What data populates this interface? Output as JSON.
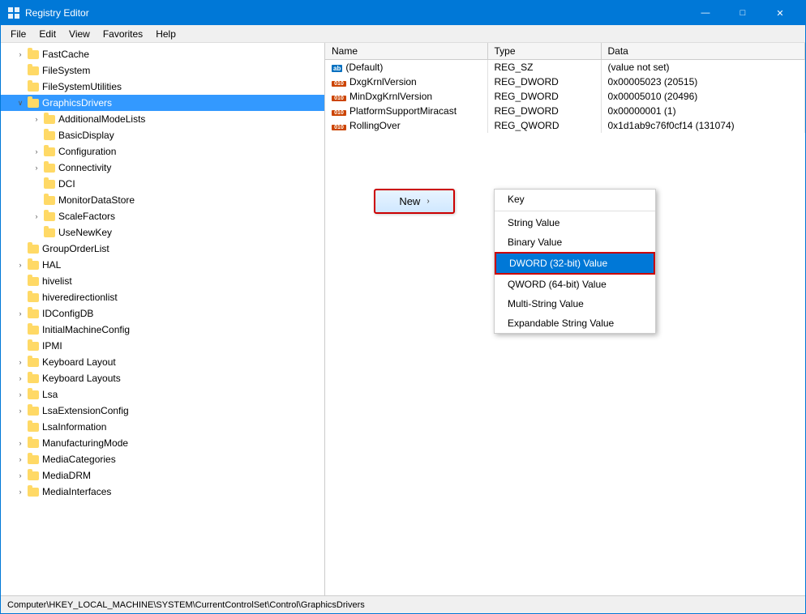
{
  "window": {
    "title": "Registry Editor",
    "controls": {
      "minimize": "—",
      "maximize": "□",
      "close": "✕"
    }
  },
  "menu": {
    "items": [
      "File",
      "Edit",
      "View",
      "Favorites",
      "Help"
    ]
  },
  "tree": {
    "items": [
      {
        "label": "FastCache",
        "indent": 1,
        "expanded": false,
        "hasChildren": false
      },
      {
        "label": "FileSystem",
        "indent": 1,
        "expanded": false,
        "hasChildren": false
      },
      {
        "label": "FileSystemUtilities",
        "indent": 1,
        "expanded": false,
        "hasChildren": false
      },
      {
        "label": "GraphicsDrivers",
        "indent": 1,
        "expanded": true,
        "hasChildren": true,
        "selected": true
      },
      {
        "label": "AdditionalModeLists",
        "indent": 2,
        "expanded": false,
        "hasChildren": true
      },
      {
        "label": "BasicDisplay",
        "indent": 2,
        "expanded": false,
        "hasChildren": false
      },
      {
        "label": "Configuration",
        "indent": 2,
        "expanded": false,
        "hasChildren": true
      },
      {
        "label": "Connectivity",
        "indent": 2,
        "expanded": false,
        "hasChildren": true
      },
      {
        "label": "DCI",
        "indent": 2,
        "expanded": false,
        "hasChildren": false
      },
      {
        "label": "MonitorDataStore",
        "indent": 2,
        "expanded": false,
        "hasChildren": false
      },
      {
        "label": "ScaleFactors",
        "indent": 2,
        "expanded": false,
        "hasChildren": true
      },
      {
        "label": "UseNewKey",
        "indent": 2,
        "expanded": false,
        "hasChildren": false
      },
      {
        "label": "GroupOrderList",
        "indent": 1,
        "expanded": false,
        "hasChildren": false
      },
      {
        "label": "HAL",
        "indent": 1,
        "expanded": false,
        "hasChildren": true
      },
      {
        "label": "hivelist",
        "indent": 1,
        "expanded": false,
        "hasChildren": false
      },
      {
        "label": "hiveredirectionlist",
        "indent": 1,
        "expanded": false,
        "hasChildren": false
      },
      {
        "label": "IDConfigDB",
        "indent": 1,
        "expanded": false,
        "hasChildren": true
      },
      {
        "label": "InitialMachineConfig",
        "indent": 1,
        "expanded": false,
        "hasChildren": false
      },
      {
        "label": "IPMI",
        "indent": 1,
        "expanded": false,
        "hasChildren": false
      },
      {
        "label": "Keyboard Layout",
        "indent": 1,
        "expanded": false,
        "hasChildren": true
      },
      {
        "label": "Keyboard Layouts",
        "indent": 1,
        "expanded": false,
        "hasChildren": true
      },
      {
        "label": "Lsa",
        "indent": 1,
        "expanded": false,
        "hasChildren": true
      },
      {
        "label": "LsaExtensionConfig",
        "indent": 1,
        "expanded": false,
        "hasChildren": true
      },
      {
        "label": "LsaInformation",
        "indent": 1,
        "expanded": false,
        "hasChildren": false
      },
      {
        "label": "ManufacturingMode",
        "indent": 1,
        "expanded": false,
        "hasChildren": true
      },
      {
        "label": "MediaCategories",
        "indent": 1,
        "expanded": false,
        "hasChildren": true
      },
      {
        "label": "MediaDRM",
        "indent": 1,
        "expanded": false,
        "hasChildren": true
      },
      {
        "label": "MediaInterfaces",
        "indent": 1,
        "expanded": false,
        "hasChildren": true
      }
    ]
  },
  "registry_table": {
    "columns": [
      "Name",
      "Type",
      "Data"
    ],
    "rows": [
      {
        "name": "(Default)",
        "type": "REG_SZ",
        "data": "(value not set)",
        "icon": "ab"
      },
      {
        "name": "DxgKrnlVersion",
        "type": "REG_DWORD",
        "data": "0x00005023 (20515)",
        "icon": "dword"
      },
      {
        "name": "MinDxgKrnlVersion",
        "type": "REG_DWORD",
        "data": "0x00005010 (20496)",
        "icon": "dword"
      },
      {
        "name": "PlatformSupportMiracast",
        "type": "REG_DWORD",
        "data": "0x00000001 (1)",
        "icon": "dword"
      },
      {
        "name": "RollingOver",
        "type": "REG_QWORD",
        "data": "0x1d1ab9c76f0cf14 (131074)",
        "icon": "dword"
      }
    ]
  },
  "context_menu": {
    "new_button_label": "New",
    "arrow": "›",
    "submenu_items": [
      {
        "label": "Key",
        "separator_after": true
      },
      {
        "label": "String Value",
        "separator_after": false
      },
      {
        "label": "Binary Value",
        "separator_after": false
      },
      {
        "label": "DWORD (32-bit) Value",
        "highlighted": true,
        "separator_after": false
      },
      {
        "label": "QWORD (64-bit) Value",
        "separator_after": false
      },
      {
        "label": "Multi-String Value",
        "separator_after": false
      },
      {
        "label": "Expandable String Value",
        "separator_after": false
      }
    ]
  },
  "status_bar": {
    "path": "Computer\\HKEY_LOCAL_MACHINE\\SYSTEM\\CurrentControlSet\\Control\\GraphicsDrivers"
  },
  "colors": {
    "title_bar": "#0078d7",
    "selected_bg": "#3399ff",
    "highlight": "#cc0000",
    "context_highlight": "#0078d7"
  }
}
